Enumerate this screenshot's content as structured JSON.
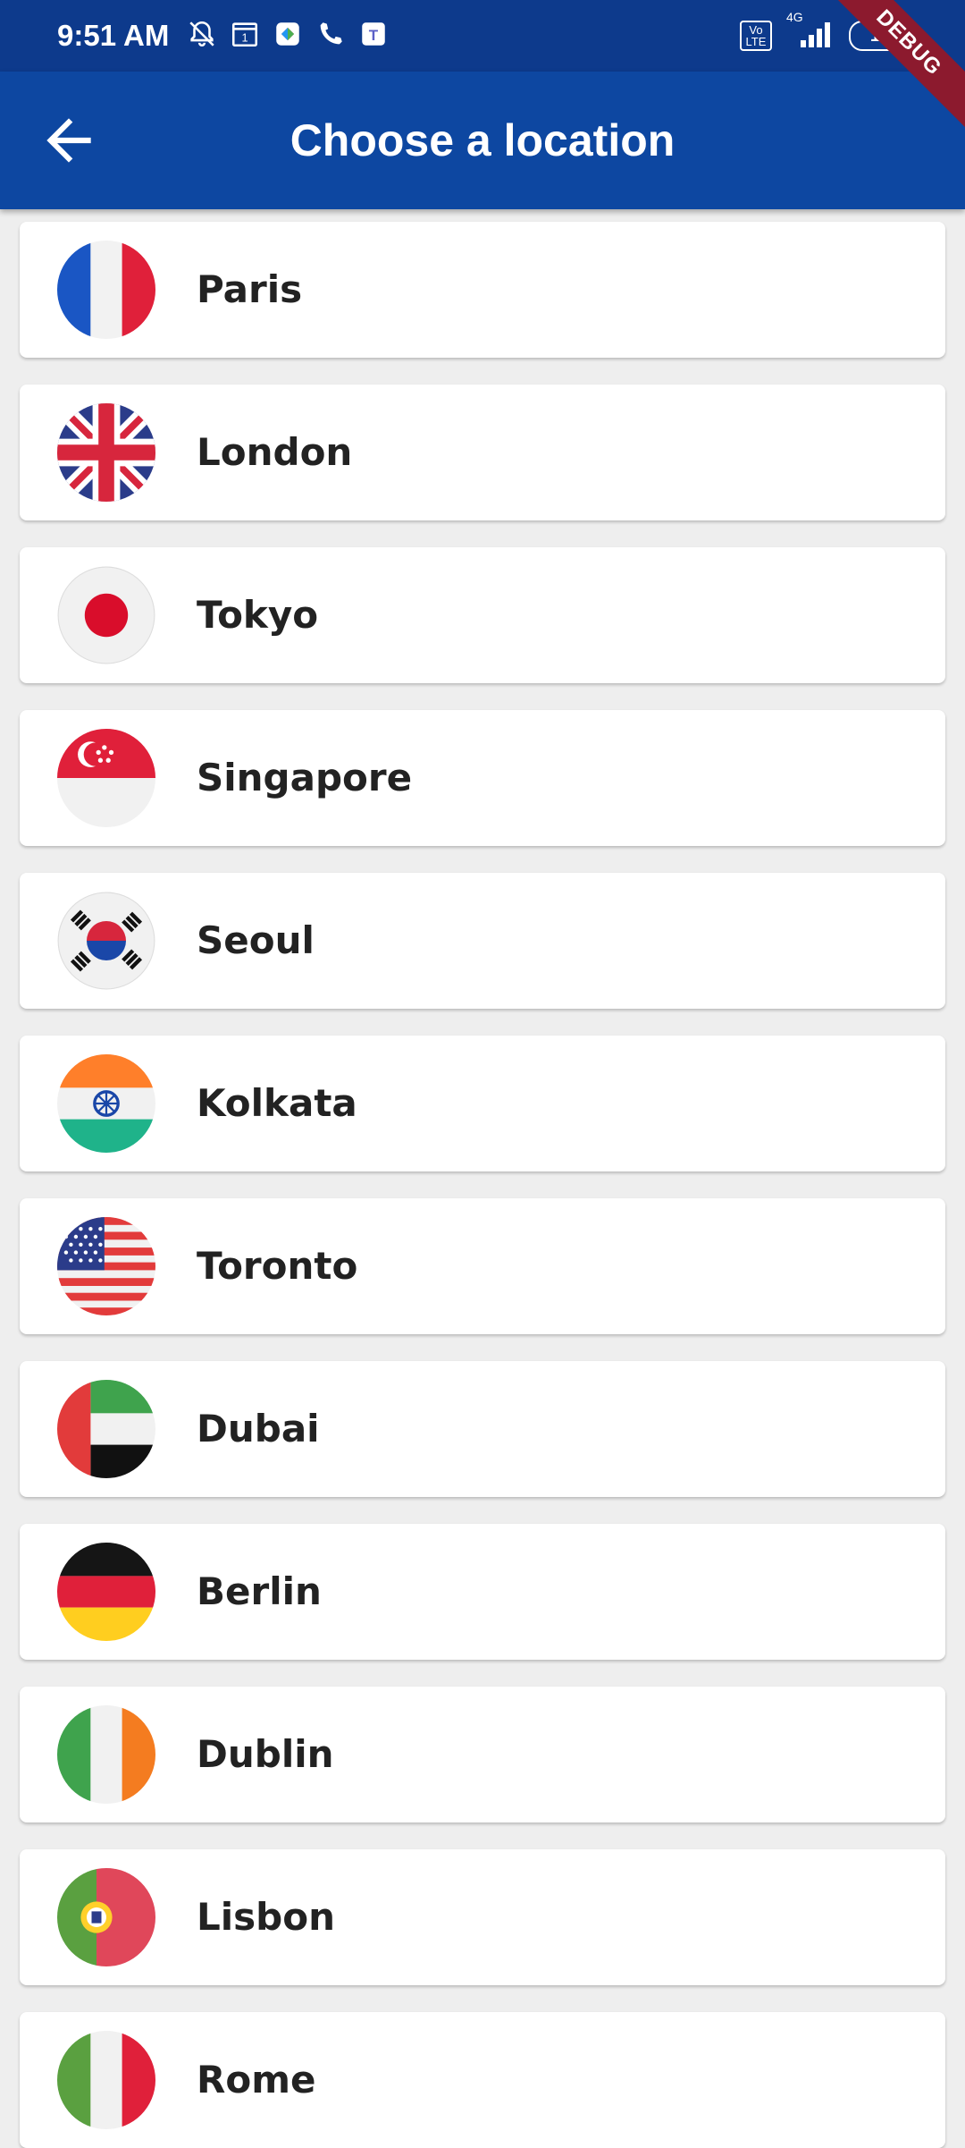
{
  "status_bar": {
    "time": "9:51 AM",
    "network": "4G",
    "volte": "Vo LTE",
    "battery": "17"
  },
  "debug_banner": "DEBUG",
  "app_bar": {
    "title": "Choose a location",
    "back_icon": "arrow-back-icon"
  },
  "locations": [
    {
      "city": "Paris",
      "flag": "france-flag-icon"
    },
    {
      "city": "London",
      "flag": "uk-flag-icon"
    },
    {
      "city": "Tokyo",
      "flag": "japan-flag-icon"
    },
    {
      "city": "Singapore",
      "flag": "singapore-flag-icon"
    },
    {
      "city": "Seoul",
      "flag": "south-korea-flag-icon"
    },
    {
      "city": "Kolkata",
      "flag": "india-flag-icon"
    },
    {
      "city": "Toronto",
      "flag": "usa-flag-icon"
    },
    {
      "city": "Dubai",
      "flag": "uae-flag-icon"
    },
    {
      "city": "Berlin",
      "flag": "germany-flag-icon"
    },
    {
      "city": "Dublin",
      "flag": "ireland-flag-icon"
    },
    {
      "city": "Lisbon",
      "flag": "portugal-flag-icon"
    },
    {
      "city": "Rome",
      "flag": "italy-flag-icon"
    }
  ],
  "colors": {
    "app_bar": "#0d47a1",
    "status_bar": "#0d3a8c",
    "background": "#eeeeee",
    "card": "#ffffff"
  }
}
